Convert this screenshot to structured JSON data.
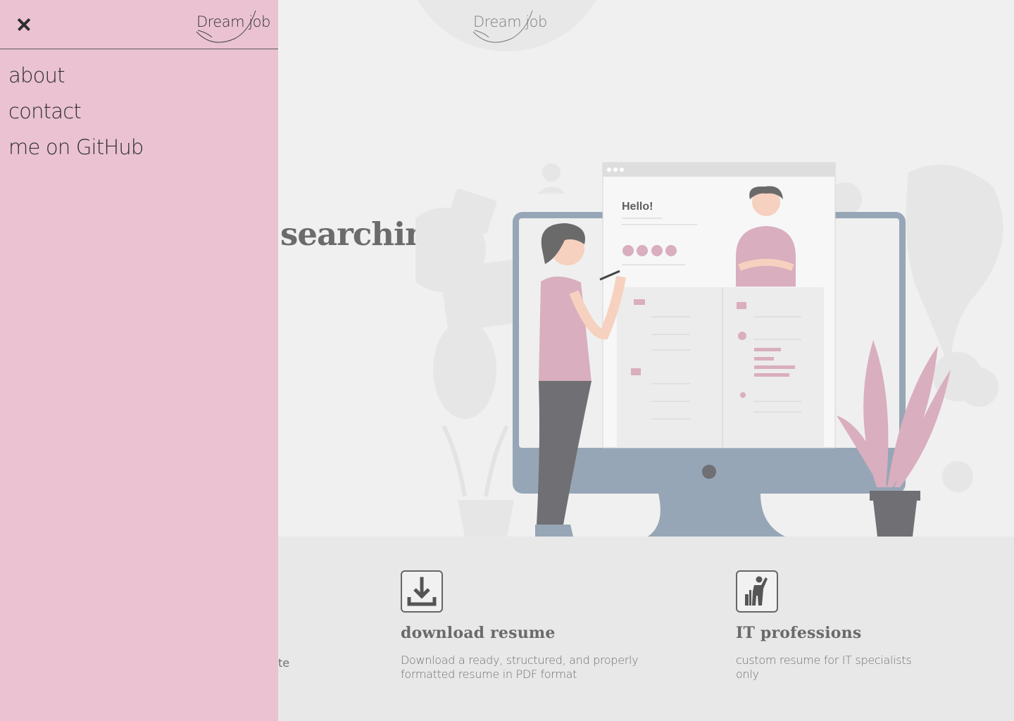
{
  "brand": {
    "logo_text": "Dream job"
  },
  "drawer": {
    "close_icon": "close-icon",
    "nav_items": [
      {
        "label": "about"
      },
      {
        "label": "contact"
      },
      {
        "label": "me on GitHub"
      }
    ]
  },
  "hero": {
    "heading_visible": "searching",
    "illustration": {
      "greeting": "Hello!"
    }
  },
  "features": {
    "partial_text": "te",
    "items": [
      {
        "icon": "download-icon",
        "title": "download resume",
        "description": "Download a ready, structured, and properly formatted resume in PDF format"
      },
      {
        "icon": "professional-person-icon",
        "title": "IT professions",
        "description": "custom resume for IT specialists only"
      }
    ]
  },
  "colors": {
    "drawer_bg": "#eac2d2",
    "page_bg": "#f0f0f0",
    "features_bg": "#e8e8e8",
    "accent_pink": "#d9aebe",
    "monitor_blue": "#96a6b6"
  }
}
